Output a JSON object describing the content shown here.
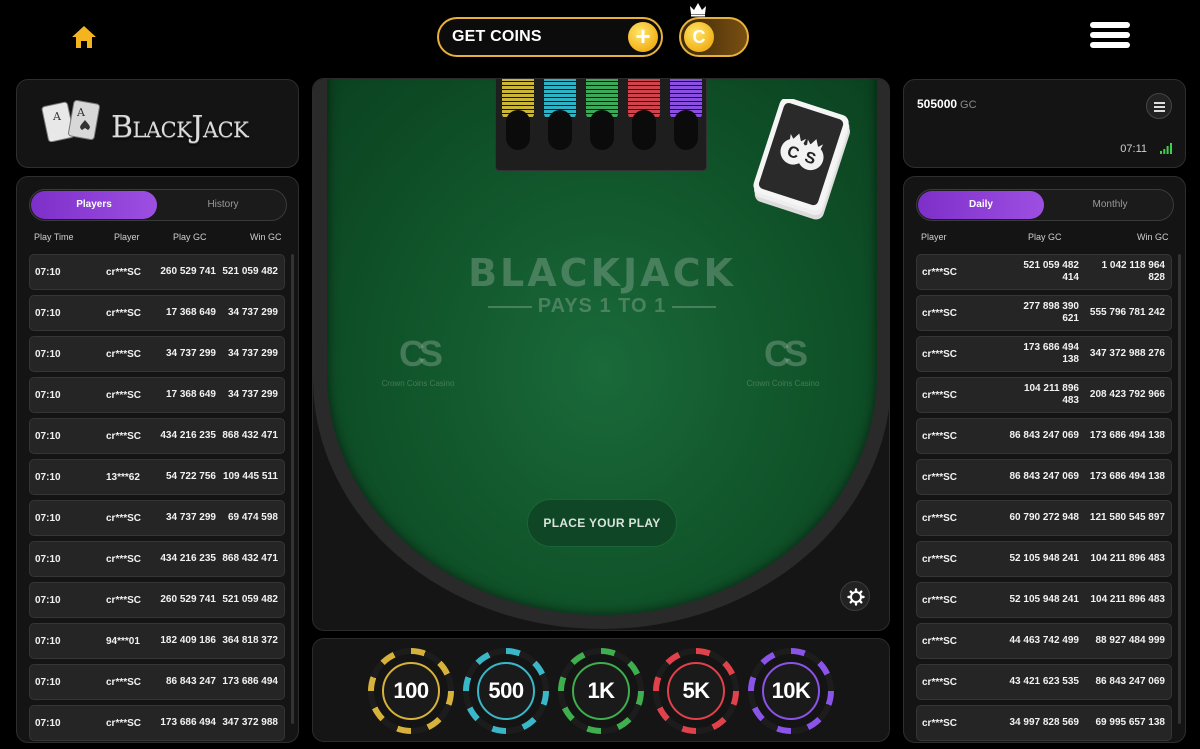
{
  "header": {
    "get_coins_label": "GET COINS",
    "coin_symbol": "C",
    "plus_symbol": "+"
  },
  "logo": {
    "title": "BlackJack"
  },
  "balance": {
    "amount": "505000",
    "currency": "GC",
    "time": "07:11"
  },
  "left_table": {
    "tabs": [
      {
        "label": "Players",
        "active": true
      },
      {
        "label": "History",
        "active": false
      }
    ],
    "columns": [
      "Play Time",
      "Player",
      "Play GC",
      "Win GC"
    ],
    "rows": [
      [
        "07:10",
        "cr***SC",
        "260 529 741",
        "521 059 482"
      ],
      [
        "07:10",
        "cr***SC",
        "17 368 649",
        "34 737 299"
      ],
      [
        "07:10",
        "cr***SC",
        "34 737 299",
        "34 737 299"
      ],
      [
        "07:10",
        "cr***SC",
        "17 368 649",
        "34 737 299"
      ],
      [
        "07:10",
        "cr***SC",
        "434 216 235",
        "868 432 471"
      ],
      [
        "07:10",
        "13***62",
        "54 722 756",
        "109 445 511"
      ],
      [
        "07:10",
        "cr***SC",
        "34 737 299",
        "69 474 598"
      ],
      [
        "07:10",
        "cr***SC",
        "434 216 235",
        "868 432 471"
      ],
      [
        "07:10",
        "cr***SC",
        "260 529 741",
        "521 059 482"
      ],
      [
        "07:10",
        "94***01",
        "182 409 186",
        "364 818 372"
      ],
      [
        "07:10",
        "cr***SC",
        "86 843 247",
        "173 686 494"
      ],
      [
        "07:10",
        "cr***SC",
        "173 686 494",
        "347 372 988"
      ]
    ]
  },
  "right_table": {
    "tabs": [
      {
        "label": "Daily",
        "active": true
      },
      {
        "label": "Monthly",
        "active": false
      }
    ],
    "columns": [
      "Player",
      "Play GC",
      "Win GC"
    ],
    "rows": [
      [
        "cr***SC",
        "521 059 482 414",
        "1 042 118 964 828"
      ],
      [
        "cr***SC",
        "277 898 390 621",
        "555 796 781 242"
      ],
      [
        "cr***SC",
        "173 686 494 138",
        "347 372 988 276"
      ],
      [
        "cr***SC",
        "104 211 896 483",
        "208 423 792 966"
      ],
      [
        "cr***SC",
        "86 843 247 069",
        "173 686 494 138"
      ],
      [
        "cr***SC",
        "86 843 247 069",
        "173 686 494 138"
      ],
      [
        "cr***SC",
        "60 790 272 948",
        "121 580 545 897"
      ],
      [
        "cr***SC",
        "52 105 948 241",
        "104 211 896 483"
      ],
      [
        "cr***SC",
        "52 105 948 241",
        "104 211 896 483"
      ],
      [
        "cr***SC",
        "44 463 742 499",
        "88 927 484 999"
      ],
      [
        "cr***SC",
        "43 421 623 535",
        "86 843 247 069"
      ],
      [
        "cr***SC",
        "34 997 828 569",
        "69 995 657 138"
      ]
    ]
  },
  "table": {
    "title": "BLACKJACK",
    "subtitle": "PAYS 1 TO 1",
    "watermark_letters": "CS",
    "watermark_caption": "Crown Coins Casino",
    "deck_letters": "CS",
    "place_button": "PLACE YOUR PLAY"
  },
  "chips": [
    {
      "label": "100",
      "color": "#d7b23b"
    },
    {
      "label": "500",
      "color": "#39b7c9"
    },
    {
      "label": "1K",
      "color": "#3fae4e"
    },
    {
      "label": "5K",
      "color": "#e0414a"
    },
    {
      "label": "10K",
      "color": "#8b54e8"
    }
  ],
  "tray_stacks": [
    "#c9b53a",
    "#2fb3c4",
    "#3da85a",
    "#d0424c",
    "#8a4fe0"
  ]
}
